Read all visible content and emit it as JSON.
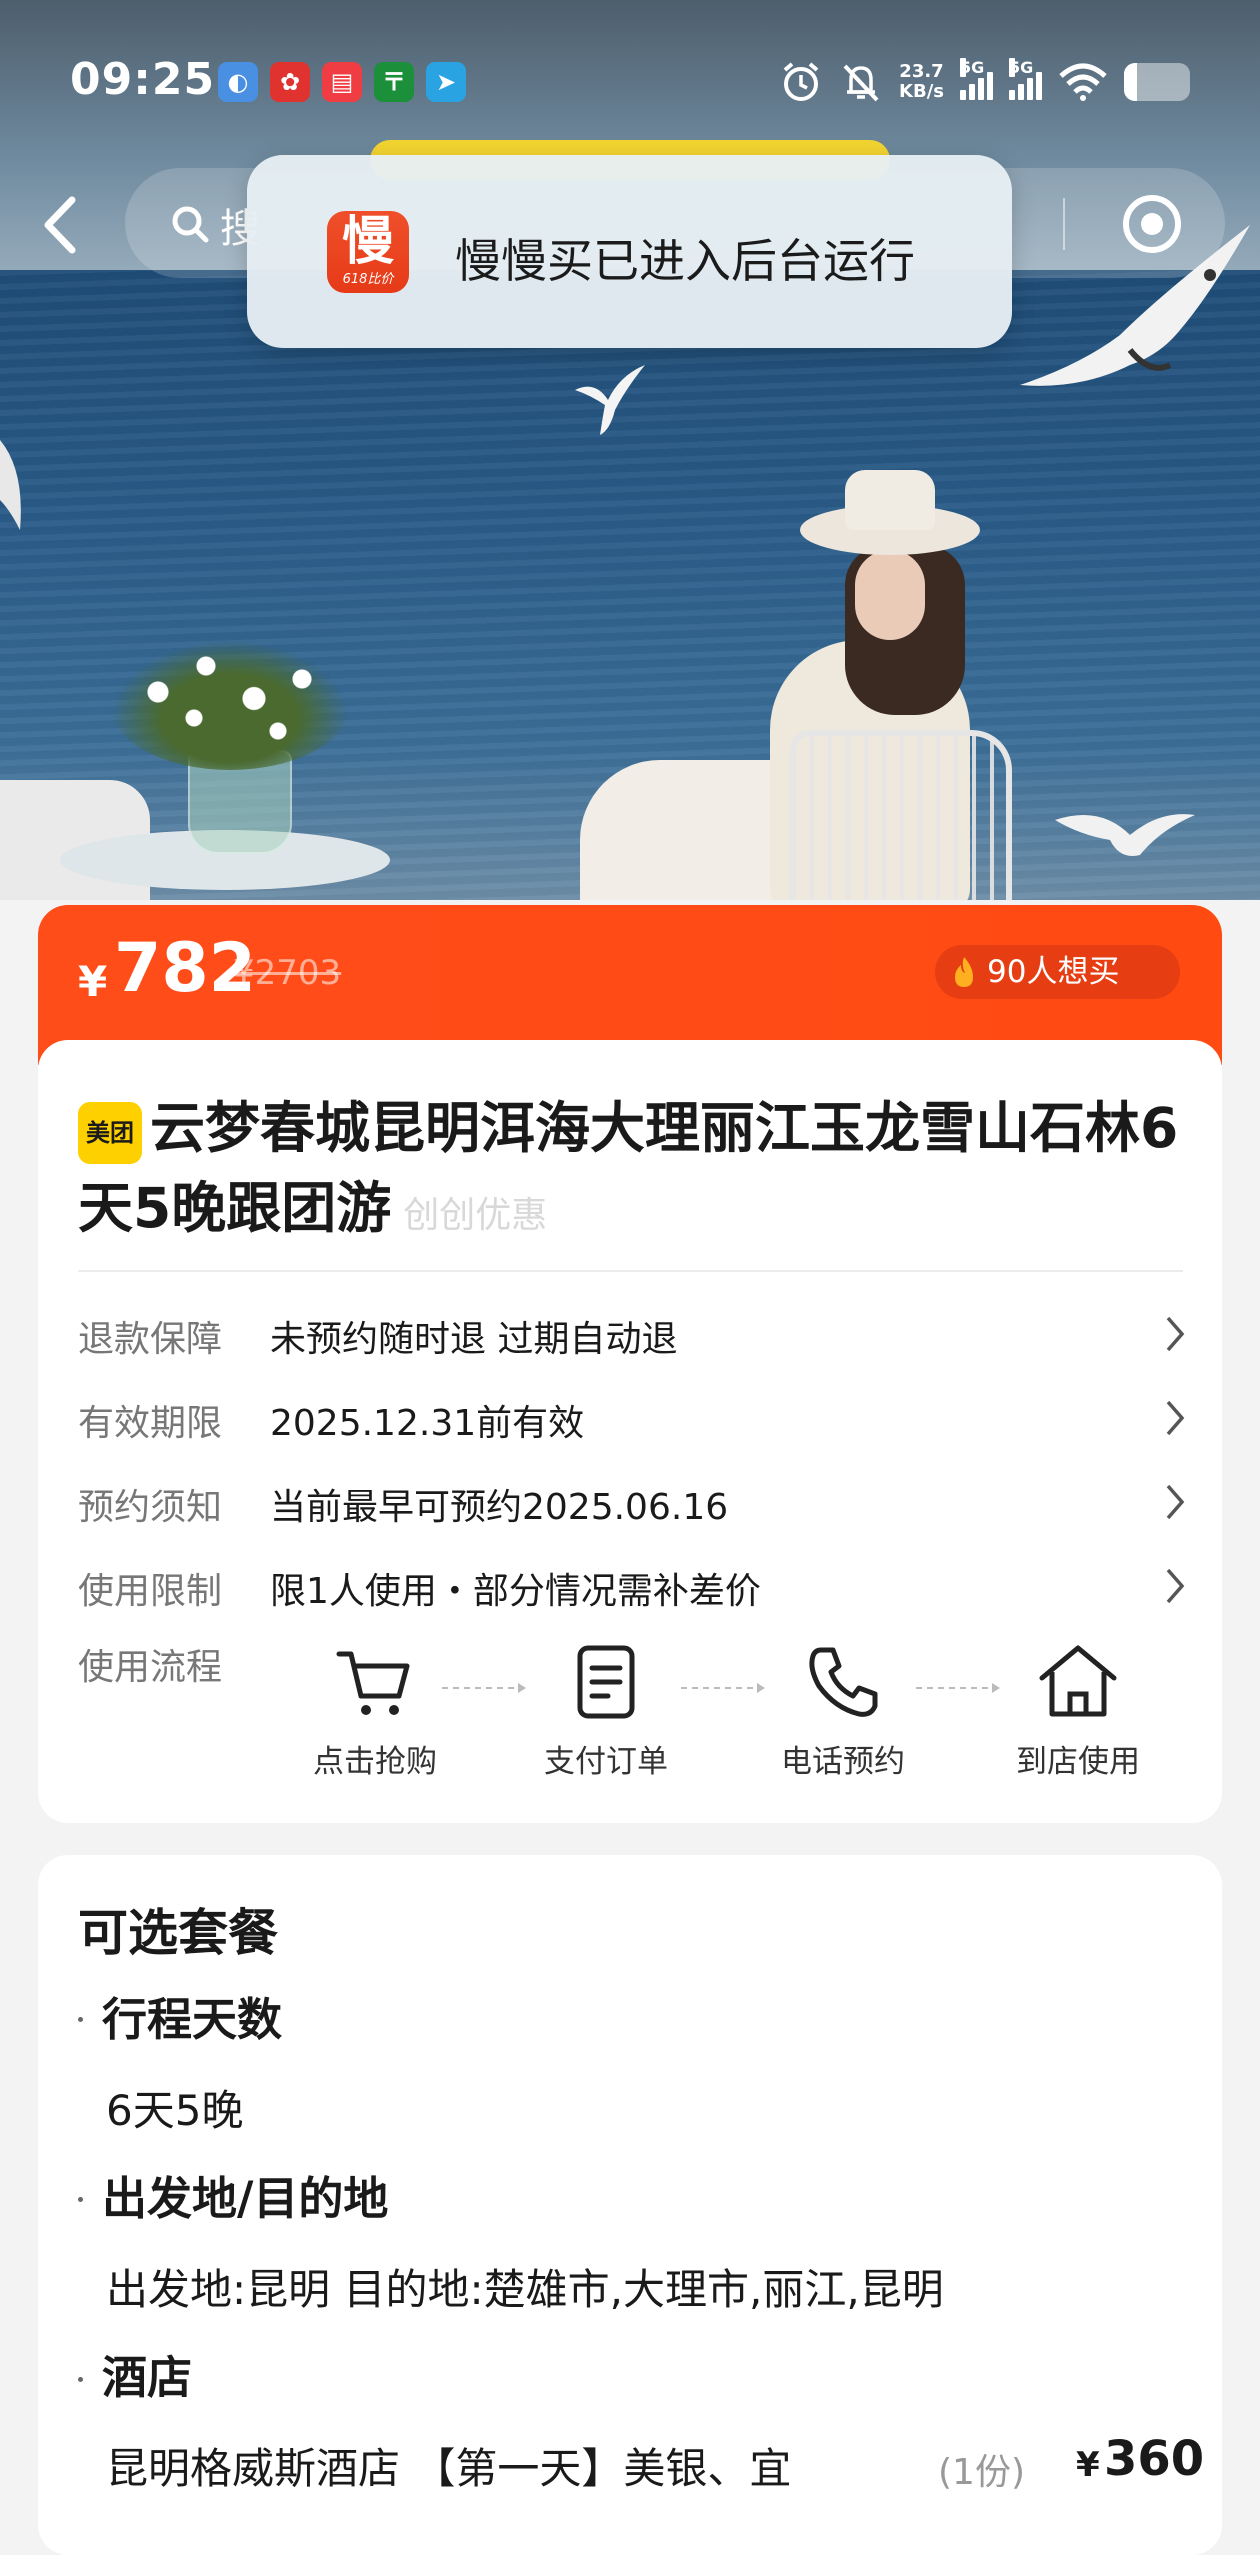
{
  "status_bar": {
    "time": "09:25",
    "speed_value": "23.7",
    "speed_unit": "KB/s",
    "network_1": "5G",
    "network_2": "5G",
    "battery_level": 0.2,
    "app_icons": [
      "app-icon-blue",
      "app-icon-red-flower",
      "app-icon-red-can",
      "app-icon-postal",
      "app-icon-telegram"
    ]
  },
  "nav": {
    "search_text": "搜",
    "back_icon": "chevron-left-icon",
    "target_icon": "target-icon"
  },
  "toast": {
    "app_icon_char": "慢",
    "app_icon_sub": "618比价",
    "message": "慢慢买已进入后台运行"
  },
  "price": {
    "currency": "¥",
    "current": "782",
    "original": "¥2703",
    "want_count": "90人想买"
  },
  "product": {
    "badge": "美团",
    "title": "云梦春城昆明洱海大理丽江玉龙雪山石林6天5晚跟团游",
    "tag": "创创优惠"
  },
  "info_rows": [
    {
      "label": "退款保障",
      "value": "未预约随时退 过期自动退"
    },
    {
      "label": "有效期限",
      "value": "2025.12.31前有效"
    },
    {
      "label": "预约须知",
      "value": "当前最早可预约2025.06.16"
    },
    {
      "label": "使用限制",
      "value": "限1人使用・部分情况需补差价"
    }
  ],
  "process": {
    "label": "使用流程",
    "steps": [
      "点击抢购",
      "支付订单",
      "电话预约",
      "到店使用"
    ]
  },
  "packages": {
    "title": "可选套餐",
    "days_label": "行程天数",
    "days_value": "6天5晚",
    "route_label": "出发地/目的地",
    "route_value": "出发地:昆明 目的地:楚雄市,大理市,丽江,昆明",
    "hotel_label": "酒店",
    "hotel_value": "昆明格威斯酒店 【第一天】美银、宜",
    "hotel_qty": "(1份)",
    "hotel_currency": "¥",
    "hotel_price": "360"
  },
  "colors": {
    "accent": "#ff4d1a",
    "badge_yellow": "#ffd000",
    "toast_red": "#e63a17"
  }
}
